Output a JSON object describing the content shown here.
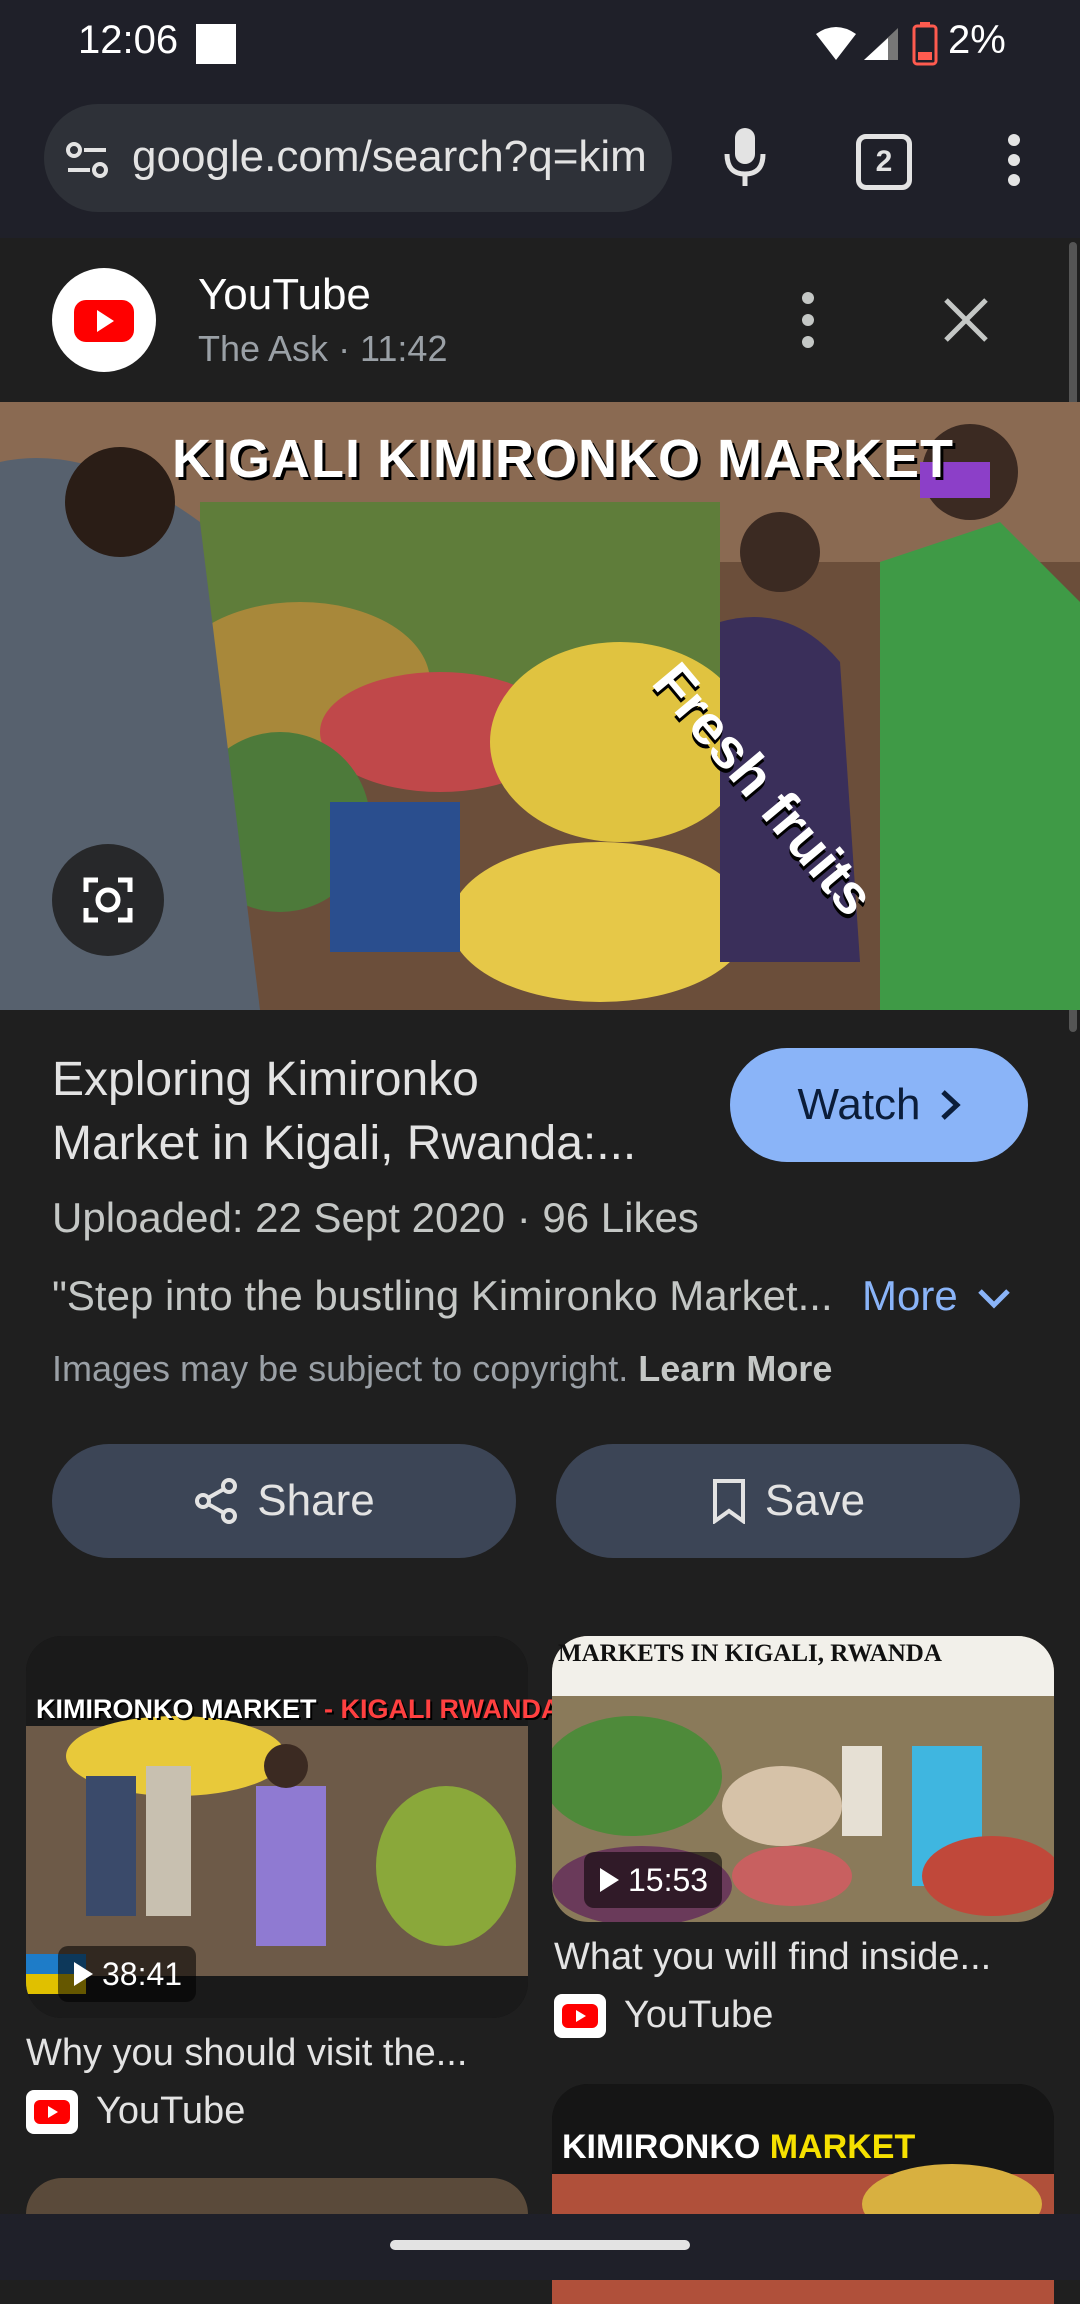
{
  "status_bar": {
    "time": "12:06",
    "battery": "2%"
  },
  "browser": {
    "url": "google.com/search?q=kim",
    "tab_count": "2"
  },
  "source": {
    "name": "YouTube",
    "subtitle": "The Ask · 11:42"
  },
  "image_overlay": {
    "title": "KIGALI KIMIRONKO MARKET",
    "caption": "Fresh fruits"
  },
  "result": {
    "title_line1": "Exploring Kimironko",
    "title_line2": "Market in Kigali, Rwanda:...",
    "watch_label": "Watch",
    "meta": "Uploaded: 22 Sept 2020  ·  96 Likes",
    "description": "\"Step into the bustling Kimironko Market...",
    "more_label": "More",
    "copyright_text": "Images may be subject to copyright.",
    "learn_more": "Learn More"
  },
  "actions": {
    "share": "Share",
    "save": "Save"
  },
  "related": [
    {
      "overlay": "KIMIRONKO MARKET",
      "overlay2": "- KIGALI RWANDA",
      "duration": "38:41",
      "title": "Why you should visit the...",
      "source": "YouTube"
    },
    {
      "overlay": "MARKETS IN KIGALI, RWANDA",
      "duration": "15:53",
      "title": "What you will find inside...",
      "source": "YouTube"
    },
    {
      "overlay": "KIMIRONKO",
      "overlay2": "MARKET"
    }
  ],
  "colors": {
    "accent": "#8ab4f8",
    "youtube_red": "#ff0000",
    "chip_bg": "#3c4556"
  }
}
